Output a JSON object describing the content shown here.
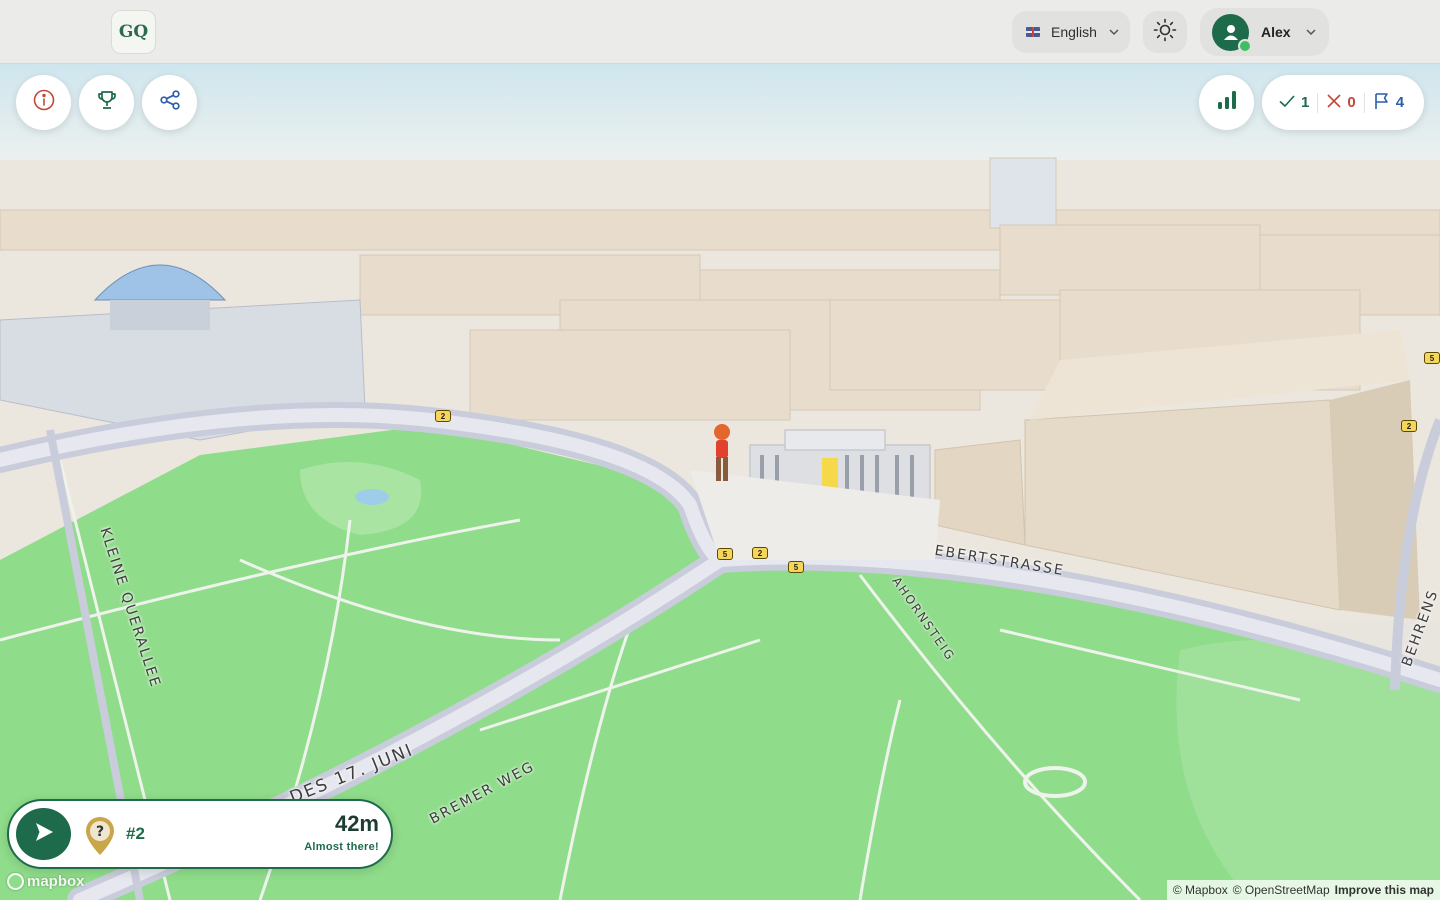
{
  "app": {
    "logo_text": "GQ"
  },
  "header": {
    "language_label": "English",
    "user_name": "Alex"
  },
  "score": {
    "correct": "1",
    "wrong": "0",
    "flags": "4"
  },
  "navigation": {
    "target_label": "#2",
    "distance": "42m",
    "status": "Almost there!"
  },
  "map": {
    "streets": [
      "KLEINE QUERALLEE",
      "EBERTSTRASSE",
      "AHORNSTEIG",
      "BREMER WEG",
      "DES 17. JUNI",
      "BEHRENS"
    ],
    "road_shields": [
      "2",
      "5",
      "2",
      "5",
      "2",
      "5",
      "5"
    ],
    "mapbox_logo": "mapbox",
    "attribution": {
      "mapbox": "© Mapbox",
      "osm": "© OpenStreetMap",
      "improve": "Improve this map"
    }
  },
  "icons": {
    "info": "info-icon",
    "trophy": "trophy-icon",
    "share": "share-icon",
    "stats": "bar-chart-icon",
    "theme": "sun-icon",
    "go": "navigation-arrow-icon",
    "pin": "question-pin-icon"
  },
  "colors": {
    "brand": "#1d6b4a",
    "wrong": "#c4473a",
    "flag": "#2b5fa8",
    "park": "#8fdc8a",
    "buildings": "#e6dccd"
  }
}
